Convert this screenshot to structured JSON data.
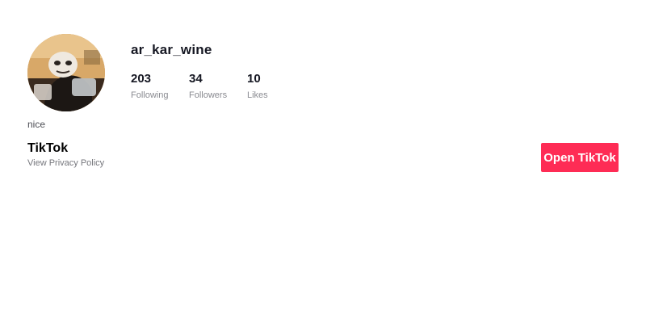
{
  "profile": {
    "username": "ar_kar_wine",
    "bio": "nice",
    "avatar_icon": "user-avatar-photo",
    "stats": [
      {
        "value": "203",
        "label": "Following"
      },
      {
        "value": "34",
        "label": "Followers"
      },
      {
        "value": "10",
        "label": "Likes"
      }
    ]
  },
  "footer": {
    "brand": "TikTok",
    "privacy_link": "View Privacy Policy"
  },
  "actions": {
    "open_label": "Open TikTok"
  },
  "colors": {
    "accent": "#fe2c55",
    "text_primary": "#161823",
    "text_secondary": "#8a8b91"
  }
}
